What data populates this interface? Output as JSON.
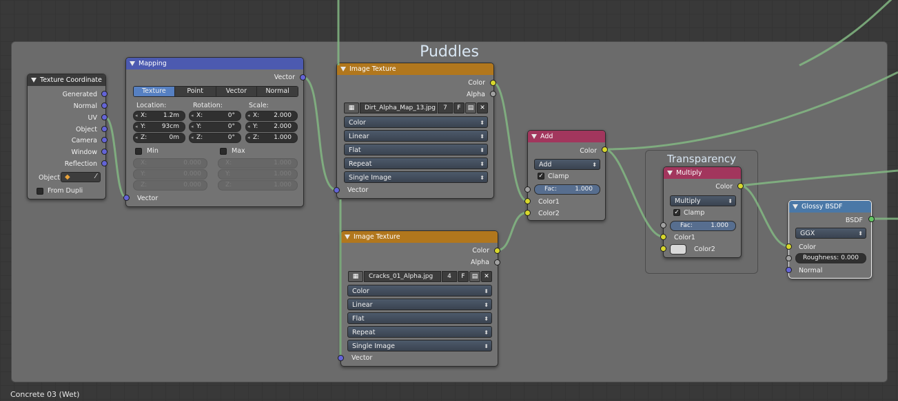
{
  "footer": {
    "material_name": "Concrete 03 (Wet)"
  },
  "frames": {
    "puddles": "Puddles",
    "transparency": "Transparency"
  },
  "texture_coordinate": {
    "title": "Texture Coordinate",
    "outputs": [
      "Generated",
      "Normal",
      "UV",
      "Object",
      "Camera",
      "Window",
      "Reflection"
    ],
    "object_label": "Object",
    "from_dupli": "From Dupli",
    "from_dupli_checked": false
  },
  "mapping": {
    "title": "Mapping",
    "output": "Vector",
    "tabs": [
      "Texture",
      "Point",
      "Vector",
      "Normal"
    ],
    "active_tab": "Texture",
    "location_label": "Location:",
    "rotation_label": "Rotation:",
    "scale_label": "Scale:",
    "location": {
      "x_key": "X:",
      "x": "1.2m",
      "y_key": "Y:",
      "y": "93cm",
      "z_key": "Z:",
      "z": "0m"
    },
    "rotation": {
      "x_key": "X:",
      "x": "0°",
      "y_key": "Y:",
      "y": "0°",
      "z_key": "Z:",
      "z": "0°"
    },
    "scale": {
      "x_key": "X:",
      "x": "2.000",
      "y_key": "Y:",
      "y": "2.000",
      "z_key": "Z:",
      "z": "1.000"
    },
    "min_label": "Min",
    "max_label": "Max",
    "min": {
      "x_key": "X:",
      "x": "0.000",
      "y_key": "Y:",
      "y": "0.000",
      "z_key": "Z:",
      "z": "0.000"
    },
    "max": {
      "x_key": "X:",
      "x": "1.000",
      "y_key": "Y:",
      "y": "1.000",
      "z_key": "Z:",
      "z": "1.000"
    },
    "input": "Vector"
  },
  "image_texture_1": {
    "title": "Image Texture",
    "outputs": [
      "Color",
      "Alpha"
    ],
    "image_name": "Dirt_Alpha_Map_13.jpg",
    "users": "7",
    "fake_user": "F",
    "color_space": "Color",
    "interpolation": "Linear",
    "projection": "Flat",
    "extension": "Repeat",
    "source": "Single Image",
    "input": "Vector"
  },
  "image_texture_2": {
    "title": "Image Texture",
    "outputs": [
      "Color",
      "Alpha"
    ],
    "image_name": "Cracks_01_Alpha.jpg",
    "users": "4",
    "fake_user": "F",
    "color_space": "Color",
    "interpolation": "Linear",
    "projection": "Flat",
    "extension": "Repeat",
    "source": "Single Image",
    "input": "Vector"
  },
  "add_node": {
    "title": "Add",
    "output": "Color",
    "blend_mode": "Add",
    "clamp": "Clamp",
    "clamp_checked": true,
    "fac_label": "Fac:",
    "fac": "1.000",
    "inputs": [
      "Color1",
      "Color2"
    ]
  },
  "multiply_node": {
    "title": "Multiply",
    "output": "Color",
    "blend_mode": "Multiply",
    "clamp": "Clamp",
    "clamp_checked": true,
    "fac_label": "Fac:",
    "fac": "1.000",
    "inputs": [
      "Color1",
      "Color2"
    ],
    "color2_swatch": "#d9d9d9"
  },
  "glossy_bsdf": {
    "title": "Glossy BSDF",
    "output": "BSDF",
    "distribution": "GGX",
    "color_label": "Color",
    "roughness_label": "Roughness:",
    "roughness": "0.000",
    "normal_label": "Normal"
  },
  "colors": {
    "background": "#393939",
    "wire": "#83b783",
    "socket_vector": "#6464d6",
    "socket_color": "#d7d72d",
    "socket_float": "#a1a1a1",
    "socket_shader": "#63c763"
  }
}
